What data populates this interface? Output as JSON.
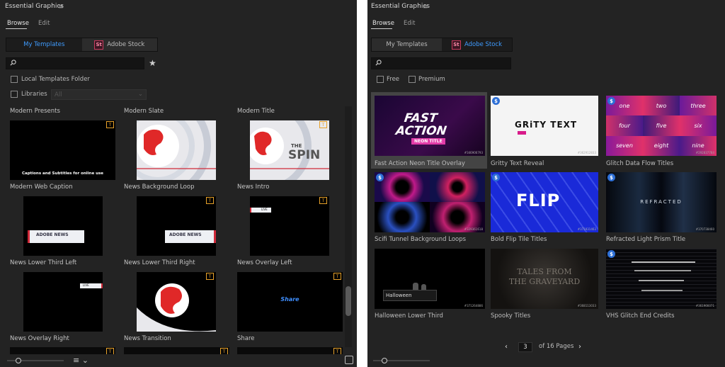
{
  "left": {
    "title": "Essential Graphics",
    "tabs": [
      "Browse",
      "Edit"
    ],
    "seg": {
      "my": "My Templates",
      "stock": "Adobe Stock",
      "st": "St"
    },
    "local": "Local Templates Folder",
    "libraries": "Libraries",
    "libsel": "All",
    "items": [
      {
        "label": "Modern Presents",
        "caption": "Captions and Subtitles for online use"
      },
      {
        "label": "Modern Slate"
      },
      {
        "label": "Modern Title",
        "spin1": "THE",
        "spin2": "SPIN"
      },
      {
        "label": "Modern Web Caption",
        "lt": "ADOBE NEWS"
      },
      {
        "label": "News Background Loop",
        "lt": "ADOBE NEWS"
      },
      {
        "label": "News Intro",
        "live": "LIVE"
      },
      {
        "label": "News Lower Third Left",
        "live": "LIVE"
      },
      {
        "label": "News Lower Third Right"
      },
      {
        "label": "News Overlay Left",
        "share": "Share"
      },
      {
        "label": "News Overlay Right"
      },
      {
        "label": "News Transition"
      },
      {
        "label": "Share"
      }
    ]
  },
  "right": {
    "title": "Essential Graphics",
    "tabs": [
      "Browse",
      "Edit"
    ],
    "seg": {
      "my": "My Templates",
      "stock": "Adobe Stock",
      "st": "St"
    },
    "free": "Free",
    "premium": "Premium",
    "items": [
      {
        "label": "Fast Action Neon Title Overlay",
        "t1": "FAST",
        "t2": "ACTION",
        "t3": "NEON TITLE",
        "id": "#346906793"
      },
      {
        "label": "Gritty Text Reveal",
        "t1": "GRiTY TEXT",
        "id": "#362912833"
      },
      {
        "label": "Glitch Data Flow Titles",
        "words": [
          "one",
          "two",
          "three",
          "four",
          "five",
          "six",
          "seven",
          "eight",
          "nine"
        ],
        "id": "#292837784"
      },
      {
        "label": "Scifi Tunnel Background Loops",
        "id": "#329361618"
      },
      {
        "label": "Bold Flip Tile Titles",
        "t1": "FLIP",
        "id": "#371931463"
      },
      {
        "label": "Refracted Light Prism Title",
        "t1": "REFRACTED",
        "id": "#370738460"
      },
      {
        "label": "Halloween Lower Third",
        "t1": "Halloween",
        "id": "#371264886"
      },
      {
        "label": "Spooky Titles",
        "t1": "TALES FROM",
        "t2": "THE GRAVEYARD",
        "id": "#368113033"
      },
      {
        "label": "VHS Glitch End Credits",
        "id": "#361966071"
      }
    ],
    "pager": {
      "page": "3",
      "of": "of 16 Pages"
    }
  },
  "colors": {
    "accent": "#3f9cff",
    "badge": "#e8a22a",
    "stock": "#2d6fd6"
  }
}
